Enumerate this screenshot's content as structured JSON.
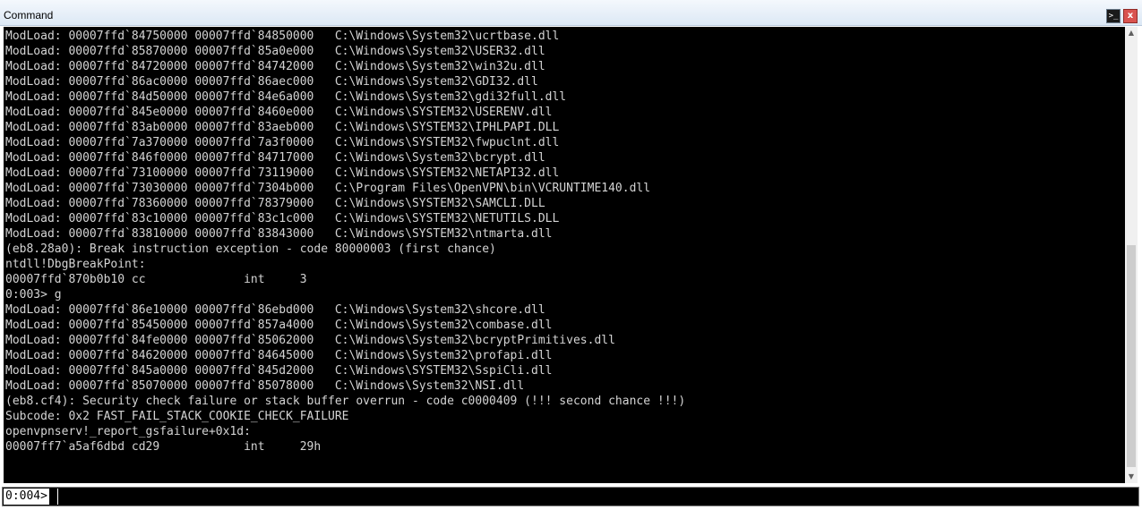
{
  "window": {
    "title": "Command",
    "cmd_icon_glyph": ">_",
    "close_icon_glyph": "x"
  },
  "output": {
    "lines": [
      "ModLoad: 00007ffd`84750000 00007ffd`84850000   C:\\Windows\\System32\\ucrtbase.dll",
      "ModLoad: 00007ffd`85870000 00007ffd`85a0e000   C:\\Windows\\System32\\USER32.dll",
      "ModLoad: 00007ffd`84720000 00007ffd`84742000   C:\\Windows\\System32\\win32u.dll",
      "ModLoad: 00007ffd`86ac0000 00007ffd`86aec000   C:\\Windows\\System32\\GDI32.dll",
      "ModLoad: 00007ffd`84d50000 00007ffd`84e6a000   C:\\Windows\\System32\\gdi32full.dll",
      "ModLoad: 00007ffd`845e0000 00007ffd`8460e000   C:\\Windows\\SYSTEM32\\USERENV.dll",
      "ModLoad: 00007ffd`83ab0000 00007ffd`83aeb000   C:\\Windows\\SYSTEM32\\IPHLPAPI.DLL",
      "ModLoad: 00007ffd`7a370000 00007ffd`7a3f0000   C:\\Windows\\SYSTEM32\\fwpuclnt.dll",
      "ModLoad: 00007ffd`846f0000 00007ffd`84717000   C:\\Windows\\System32\\bcrypt.dll",
      "ModLoad: 00007ffd`73100000 00007ffd`73119000   C:\\Windows\\SYSTEM32\\NETAPI32.dll",
      "ModLoad: 00007ffd`73030000 00007ffd`7304b000   C:\\Program Files\\OpenVPN\\bin\\VCRUNTIME140.dll",
      "ModLoad: 00007ffd`78360000 00007ffd`78379000   C:\\Windows\\SYSTEM32\\SAMCLI.DLL",
      "ModLoad: 00007ffd`83c10000 00007ffd`83c1c000   C:\\Windows\\SYSTEM32\\NETUTILS.DLL",
      "ModLoad: 00007ffd`83810000 00007ffd`83843000   C:\\Windows\\SYSTEM32\\ntmarta.dll",
      "(eb8.28a0): Break instruction exception - code 80000003 (first chance)",
      "ntdll!DbgBreakPoint:",
      "00007ffd`870b0b10 cc              int     3",
      "0:003> g",
      "ModLoad: 00007ffd`86e10000 00007ffd`86ebd000   C:\\Windows\\System32\\shcore.dll",
      "ModLoad: 00007ffd`85450000 00007ffd`857a4000   C:\\Windows\\System32\\combase.dll",
      "ModLoad: 00007ffd`84fe0000 00007ffd`85062000   C:\\Windows\\System32\\bcryptPrimitives.dll",
      "ModLoad: 00007ffd`84620000 00007ffd`84645000   C:\\Windows\\System32\\profapi.dll",
      "ModLoad: 00007ffd`845a0000 00007ffd`845d2000   C:\\Windows\\SYSTEM32\\SspiCli.dll",
      "ModLoad: 00007ffd`85070000 00007ffd`85078000   C:\\Windows\\System32\\NSI.dll",
      "(eb8.cf4): Security check failure or stack buffer overrun - code c0000409 (!!! second chance !!!)",
      "Subcode: 0x2 FAST_FAIL_STACK_COOKIE_CHECK_FAILURE",
      "openvpnserv!_report_gsfailure+0x1d:",
      "00007ff7`a5af6dbd cd29            int     29h"
    ]
  },
  "command": {
    "prompt": "0:004>",
    "value": ""
  },
  "colors": {
    "background": "#000000",
    "text": "#d4d4d4",
    "prompt_bg": "#ffffff"
  }
}
